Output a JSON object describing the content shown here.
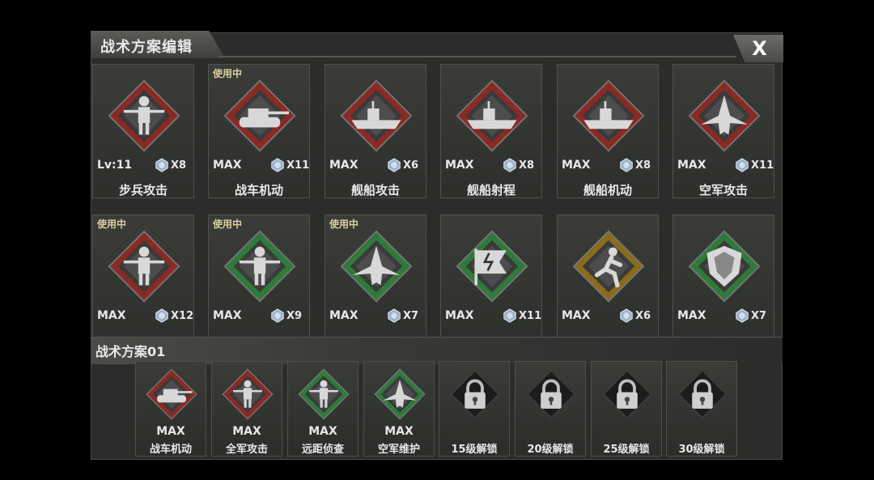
{
  "window": {
    "title": "战术方案编辑",
    "close_label": "X"
  },
  "cards": [
    {
      "in_use": "",
      "level": "Lv:11",
      "count": "X8",
      "name": "步兵攻击",
      "theme": "red",
      "icon": "infantry-attack-icon"
    },
    {
      "in_use": "使用中",
      "level": "MAX",
      "count": "X11",
      "name": "战车机动",
      "theme": "red",
      "icon": "tank-mobility-icon"
    },
    {
      "in_use": "",
      "level": "MAX",
      "count": "X6",
      "name": "舰船攻击",
      "theme": "red",
      "icon": "ship-attack-icon"
    },
    {
      "in_use": "",
      "level": "MAX",
      "count": "X8",
      "name": "舰船射程",
      "theme": "red",
      "icon": "ship-range-icon"
    },
    {
      "in_use": "",
      "level": "MAX",
      "count": "X8",
      "name": "舰船机动",
      "theme": "red",
      "icon": "ship-mobility-icon"
    },
    {
      "in_use": "",
      "level": "MAX",
      "count": "X11",
      "name": "空军攻击",
      "theme": "red",
      "icon": "airforce-attack-icon"
    },
    {
      "in_use": "使用中",
      "level": "MAX",
      "count": "X12",
      "name": "",
      "theme": "red",
      "icon": "army-attack-icon"
    },
    {
      "in_use": "使用中",
      "level": "MAX",
      "count": "X9",
      "name": "",
      "theme": "green",
      "icon": "long-range-recon-icon"
    },
    {
      "in_use": "使用中",
      "level": "MAX",
      "count": "X7",
      "name": "",
      "theme": "green",
      "icon": "airforce-maintenance-icon"
    },
    {
      "in_use": "",
      "level": "MAX",
      "count": "X11",
      "name": "",
      "theme": "green",
      "icon": "speed-flag-icon"
    },
    {
      "in_use": "",
      "level": "MAX",
      "count": "X6",
      "name": "",
      "theme": "gold",
      "icon": "runner-icon"
    },
    {
      "in_use": "",
      "level": "MAX",
      "count": "X7",
      "name": "",
      "theme": "green",
      "icon": "shield-icon"
    }
  ],
  "plan": {
    "title": "战术方案01",
    "slots": [
      {
        "level": "MAX",
        "name": "战车机动",
        "theme": "red",
        "icon": "tank-mobility-icon",
        "locked": false
      },
      {
        "level": "MAX",
        "name": "全军攻击",
        "theme": "red",
        "icon": "army-attack-icon",
        "locked": false
      },
      {
        "level": "MAX",
        "name": "远距侦查",
        "theme": "green",
        "icon": "long-range-recon-icon",
        "locked": false
      },
      {
        "level": "MAX",
        "name": "空军维护",
        "theme": "green",
        "icon": "airforce-maintenance-icon",
        "locked": false
      },
      {
        "level": "",
        "name": "15级解锁",
        "theme": "lock",
        "icon": "lock-icon",
        "locked": true
      },
      {
        "level": "",
        "name": "20级解锁",
        "theme": "lock",
        "icon": "lock-icon",
        "locked": true
      },
      {
        "level": "",
        "name": "25级解锁",
        "theme": "lock",
        "icon": "lock-icon",
        "locked": true
      },
      {
        "level": "",
        "name": "30级解锁",
        "theme": "lock",
        "icon": "lock-icon",
        "locked": true
      }
    ]
  },
  "colors": {
    "red": "#8a2a24",
    "green": "#2f7a3a",
    "gold": "#8a6a1c",
    "lock": "#2a2a2a"
  }
}
